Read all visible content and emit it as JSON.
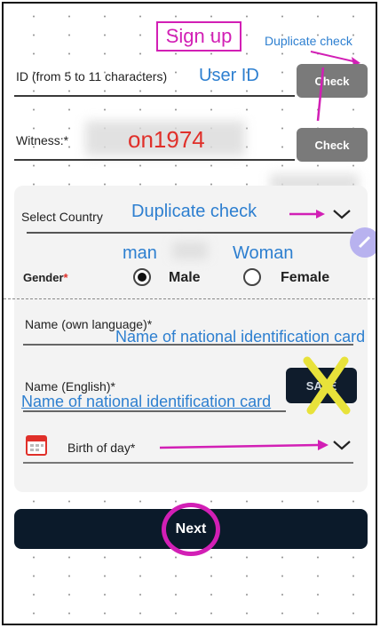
{
  "header": {
    "title": "Sign up",
    "duplicate_check_note": "Duplicate check"
  },
  "id_field": {
    "label": "ID (from 5 to 11 characters)",
    "annotation": "User ID",
    "check_label": "Check"
  },
  "witness_field": {
    "label": "Witness:*",
    "annotation": "on1974",
    "check_label": "Check"
  },
  "country": {
    "label": "Select Country",
    "annotation": "Duplicate check"
  },
  "gender": {
    "label": "Gender",
    "required_mark": "*",
    "male_label": "Male",
    "female_label": "Female",
    "male_annotation": "man",
    "female_annotation": "Woman",
    "selected": "Male"
  },
  "name_own": {
    "label": "Name (own language)*",
    "annotation": "Name of national identification card"
  },
  "name_english": {
    "label": "Name (English)*",
    "annotation": "Name of national identification card",
    "save_label": "SAVE"
  },
  "birth": {
    "label": "Birth of day*"
  },
  "footer": {
    "next_label": "Next"
  },
  "colors": {
    "annotation_blue": "#2d7fd0",
    "annotation_magenta": "#d21fb5",
    "annotation_red": "#e0302a",
    "cross_yellow": "#e8e23a",
    "button_dark": "#0b1a2a",
    "button_gray": "#7a7a7a"
  },
  "icons": [
    "chevron-down-icon",
    "calendar-icon",
    "pencil-icon",
    "arrow-icon",
    "cross-mark-icon"
  ]
}
